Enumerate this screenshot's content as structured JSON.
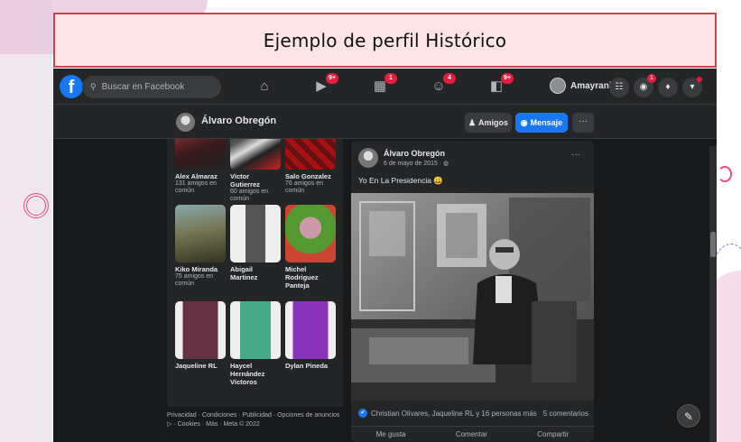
{
  "slide": {
    "title": "Ejemplo de perfil Histórico"
  },
  "topbar": {
    "logo": "f",
    "search_placeholder": "Buscar en Facebook",
    "nav": [
      {
        "icon": "home-icon",
        "glyph": "⌂",
        "badge": ""
      },
      {
        "icon": "watch-icon",
        "glyph": "▶",
        "badge": "9+"
      },
      {
        "icon": "marketplace-icon",
        "glyph": "▦",
        "badge": "1"
      },
      {
        "icon": "groups-icon",
        "glyph": "☺",
        "badge": "4"
      },
      {
        "icon": "gaming-icon",
        "glyph": "◧",
        "badge": "9+"
      }
    ],
    "user_name": "Amayrani",
    "messenger_badge": "1"
  },
  "profile_bar": {
    "name": "Álvaro Obregón",
    "friends_button": "Amigos",
    "message_button": "Mensaje",
    "more_button": "···"
  },
  "friends": [
    {
      "name": "Alex Almaraz",
      "mutual": "131 amigos en común",
      "color": "#6a3030"
    },
    {
      "name": "Victor Gutierrez",
      "mutual": "60 amigos en común",
      "color": "#3b2a2a"
    },
    {
      "name": "Salo Gonzalez",
      "mutual": "76 amigos en común",
      "color": "#8c2030"
    },
    {
      "name": "Kiko Miranda",
      "mutual": "75 amigos en común",
      "color": "#6d5c4a"
    },
    {
      "name": "Abigail Martinez",
      "mutual": "",
      "color": "#7d7d7d"
    },
    {
      "name": "Michel Rodriguez Panteja",
      "mutual": "",
      "color": "#5a6b3a"
    },
    {
      "name": "Jaqueline RL",
      "mutual": "",
      "color": "#5a4040"
    },
    {
      "name": "Haycel Hernández Victoros",
      "mutual": "",
      "color": "#3f6b7a"
    },
    {
      "name": "Dylan Pineda",
      "mutual": "",
      "color": "#7a3aa0"
    }
  ],
  "footer": {
    "line1": "Privacidad · Condiciones · Publicidad · Opciones de anuncios",
    "line2": "▷ · Cookies · Más · Meta © 2022"
  },
  "post": {
    "author": "Álvaro Obregón",
    "date": "6 de mayo de 2015 · ◍",
    "text": "Yo En La Presidencia 😀",
    "reactions_text": "Christian Olivares, Jaqueline RL y 16 personas más",
    "comments": "5 comentarios",
    "action_like": "Me gusta",
    "action_comment": "Comentar",
    "action_share": "Compartir"
  },
  "colors": {
    "banner_bg": "#fde4e6",
    "banner_border": "#c9464b",
    "fb_blue": "#1877f2",
    "badge_red": "#e41e3f",
    "dark_bg": "#18191a",
    "card_bg": "#242526"
  }
}
